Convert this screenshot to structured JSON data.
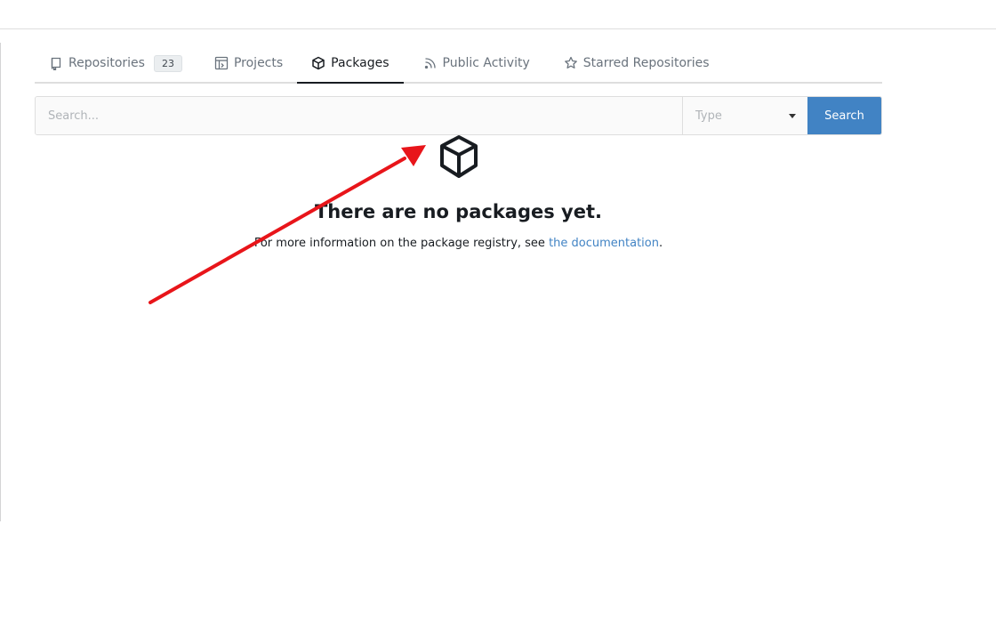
{
  "tabs": [
    {
      "label": "Repositories",
      "count": "23",
      "icon": "repo-icon"
    },
    {
      "label": "Projects",
      "icon": "project-icon"
    },
    {
      "label": "Packages",
      "icon": "package-icon",
      "active": true
    },
    {
      "label": "Public Activity",
      "icon": "rss-icon"
    },
    {
      "label": "Starred Repositories",
      "icon": "star-icon"
    }
  ],
  "search": {
    "placeholder": "Search...",
    "type_placeholder": "Type",
    "button_label": "Search"
  },
  "empty_state": {
    "title": "There are no packages yet.",
    "description_prefix": "For more information on the package registry, see ",
    "link_text": "the documentation",
    "description_suffix": "."
  },
  "annotation": {
    "arrow_color": "#e8151a"
  },
  "colors": {
    "accent": "#4183c4",
    "text": "#181c21",
    "muted": "#6a737d"
  }
}
